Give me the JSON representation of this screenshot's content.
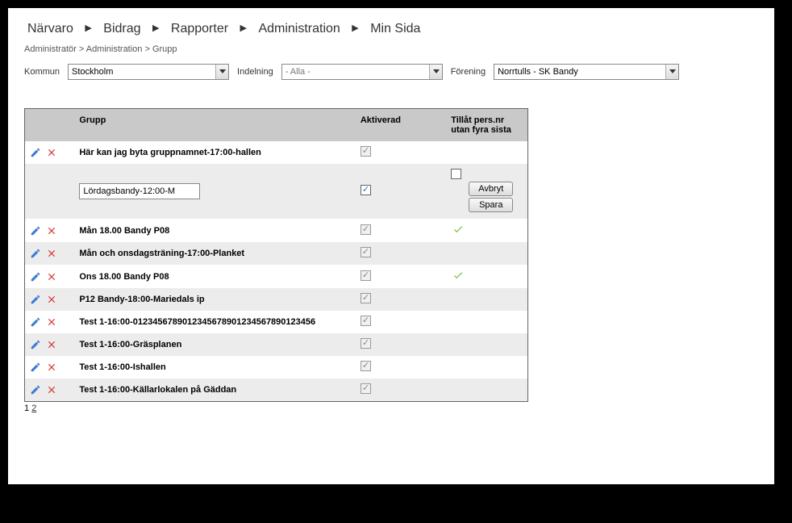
{
  "nav": {
    "items": [
      "Närvaro",
      "Bidrag",
      "Rapporter",
      "Administration",
      "Min Sida"
    ]
  },
  "breadcrumb": "Administratör > Administration > Grupp",
  "filters": {
    "kommun_label": "Kommun",
    "kommun_value": "Stockholm",
    "indelning_label": "Indelning",
    "indelning_value": "- Alla -",
    "forening_label": "Förening",
    "forening_value": "Norrtulls - SK Bandy"
  },
  "table": {
    "headers": {
      "grupp": "Grupp",
      "aktiverad": "Aktiverad",
      "tillat": "Tillåt pers.nr utan fyra sista"
    },
    "rows": [
      {
        "name": "Här kan jag byta gruppnamnet-17:00-hallen",
        "aktiverad": true,
        "tillat": false,
        "editing": false
      },
      {
        "name": "Lördagsbandy-12:00-M",
        "aktiverad": true,
        "tillat": false,
        "editing": true
      },
      {
        "name": "Mån 18.00 Bandy P08",
        "aktiverad": true,
        "tillat": true,
        "editing": false
      },
      {
        "name": "Mån och onsdagsträning-17:00-Planket",
        "aktiverad": true,
        "tillat": false,
        "editing": false
      },
      {
        "name": "Ons 18.00 Bandy P08",
        "aktiverad": true,
        "tillat": true,
        "editing": false
      },
      {
        "name": "P12 Bandy-18:00-Mariedals ip",
        "aktiverad": true,
        "tillat": false,
        "editing": false
      },
      {
        "name": "Test 1-16:00-012345678901234567890123456789012​3456",
        "aktiverad": true,
        "tillat": false,
        "editing": false
      },
      {
        "name": "Test 1-16:00-Gräsplanen",
        "aktiverad": true,
        "tillat": false,
        "editing": false
      },
      {
        "name": "Test 1-16:00-Ishallen",
        "aktiverad": true,
        "tillat": false,
        "editing": false
      },
      {
        "name": "Test 1-16:00-Källarlokalen på Gäddan",
        "aktiverad": true,
        "tillat": false,
        "editing": false
      }
    ],
    "buttons": {
      "avbryt": "Avbryt",
      "spara": "Spara"
    }
  },
  "pager": {
    "current": "1",
    "next": "2"
  }
}
